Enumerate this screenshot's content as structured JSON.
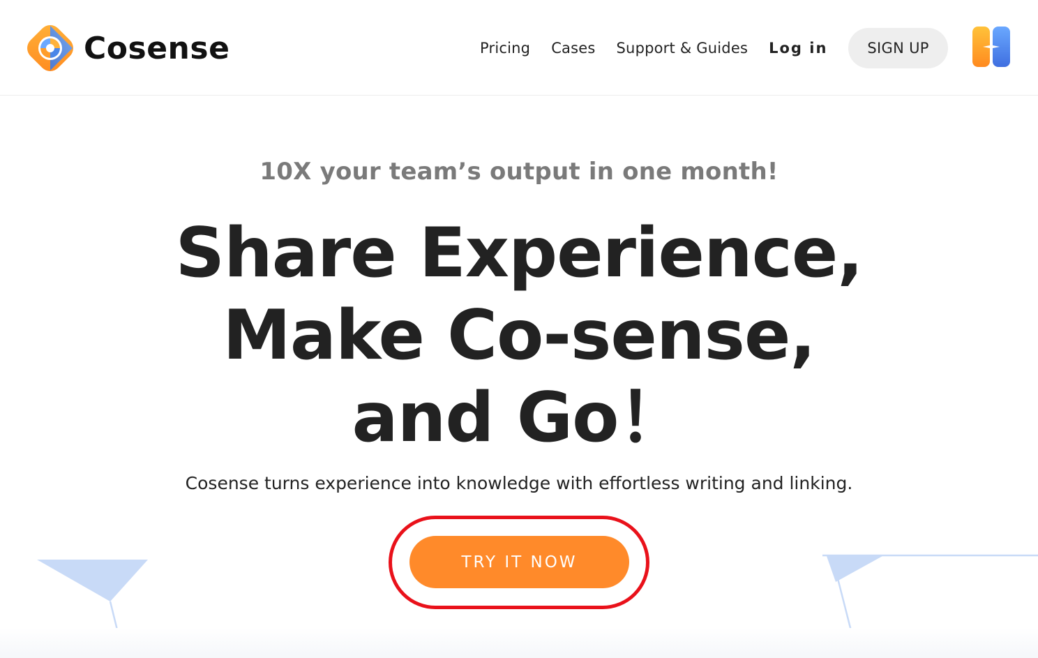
{
  "brand": {
    "name": "Cosense",
    "logo_icon": "cosense-swirl-logo",
    "colors": {
      "orange": "#ff9d2a",
      "blue": "#4a86e8"
    }
  },
  "nav": {
    "links": [
      {
        "label": "Pricing"
      },
      {
        "label": "Cases"
      },
      {
        "label": "Support & Guides"
      }
    ],
    "login_label": "Log in",
    "signup_label": "SIGN UP",
    "app_icon": "helpfeel-icon"
  },
  "hero": {
    "tagline": "10X your team’s output in one month!",
    "headline": [
      "Share Experience,",
      "Make Co-sense,",
      "and Go！"
    ],
    "subhead": "Cosense turns experience into knowledge with effortless writing and linking.",
    "cta_label": "TRY IT NOW"
  },
  "colors": {
    "cta": "#ff8a2a",
    "highlight_ring": "#e9111a",
    "signup_bg": "#eeeeee",
    "decor_blue": "#c8daf7"
  }
}
